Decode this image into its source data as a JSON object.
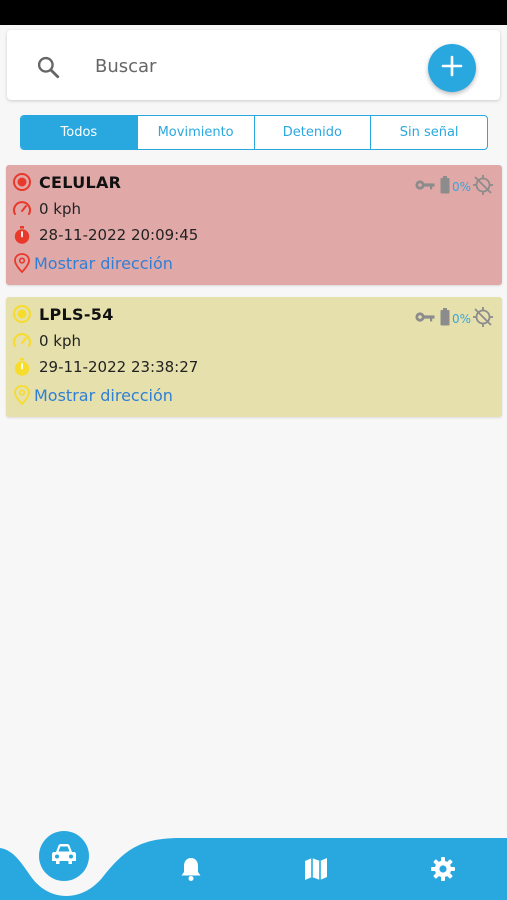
{
  "search": {
    "placeholder": "Buscar"
  },
  "colors": {
    "accent": "#29a8e0",
    "card_red": "#e1a8a8",
    "card_yellow": "#e5e0ac",
    "status_red": "#e8392b",
    "status_yellow": "#f7dc2c",
    "link": "#2f7fd6"
  },
  "tabs": [
    {
      "label": "Todos",
      "active": true
    },
    {
      "label": "Movimiento",
      "active": false
    },
    {
      "label": "Detenido",
      "active": false
    },
    {
      "label": "Sin señal",
      "active": false
    }
  ],
  "vehicles": [
    {
      "name": "CELULAR",
      "speed": "0 kph",
      "datetime": "28-11-2022 20:09:45",
      "address_link": "Mostrar dirección",
      "battery": "0%",
      "status": "red"
    },
    {
      "name": "LPLS-54",
      "speed": "0 kph",
      "datetime": "29-11-2022 23:38:27",
      "address_link": "Mostrar dirección",
      "battery": "0%",
      "status": "yellow"
    }
  ],
  "icons": [
    "search-icon",
    "plus-icon",
    "record-icon",
    "speedometer-icon",
    "stopwatch-icon",
    "location-pin-icon",
    "key-icon",
    "battery-icon",
    "gps-off-icon",
    "car-icon",
    "bell-icon",
    "map-icon",
    "gear-icon"
  ]
}
